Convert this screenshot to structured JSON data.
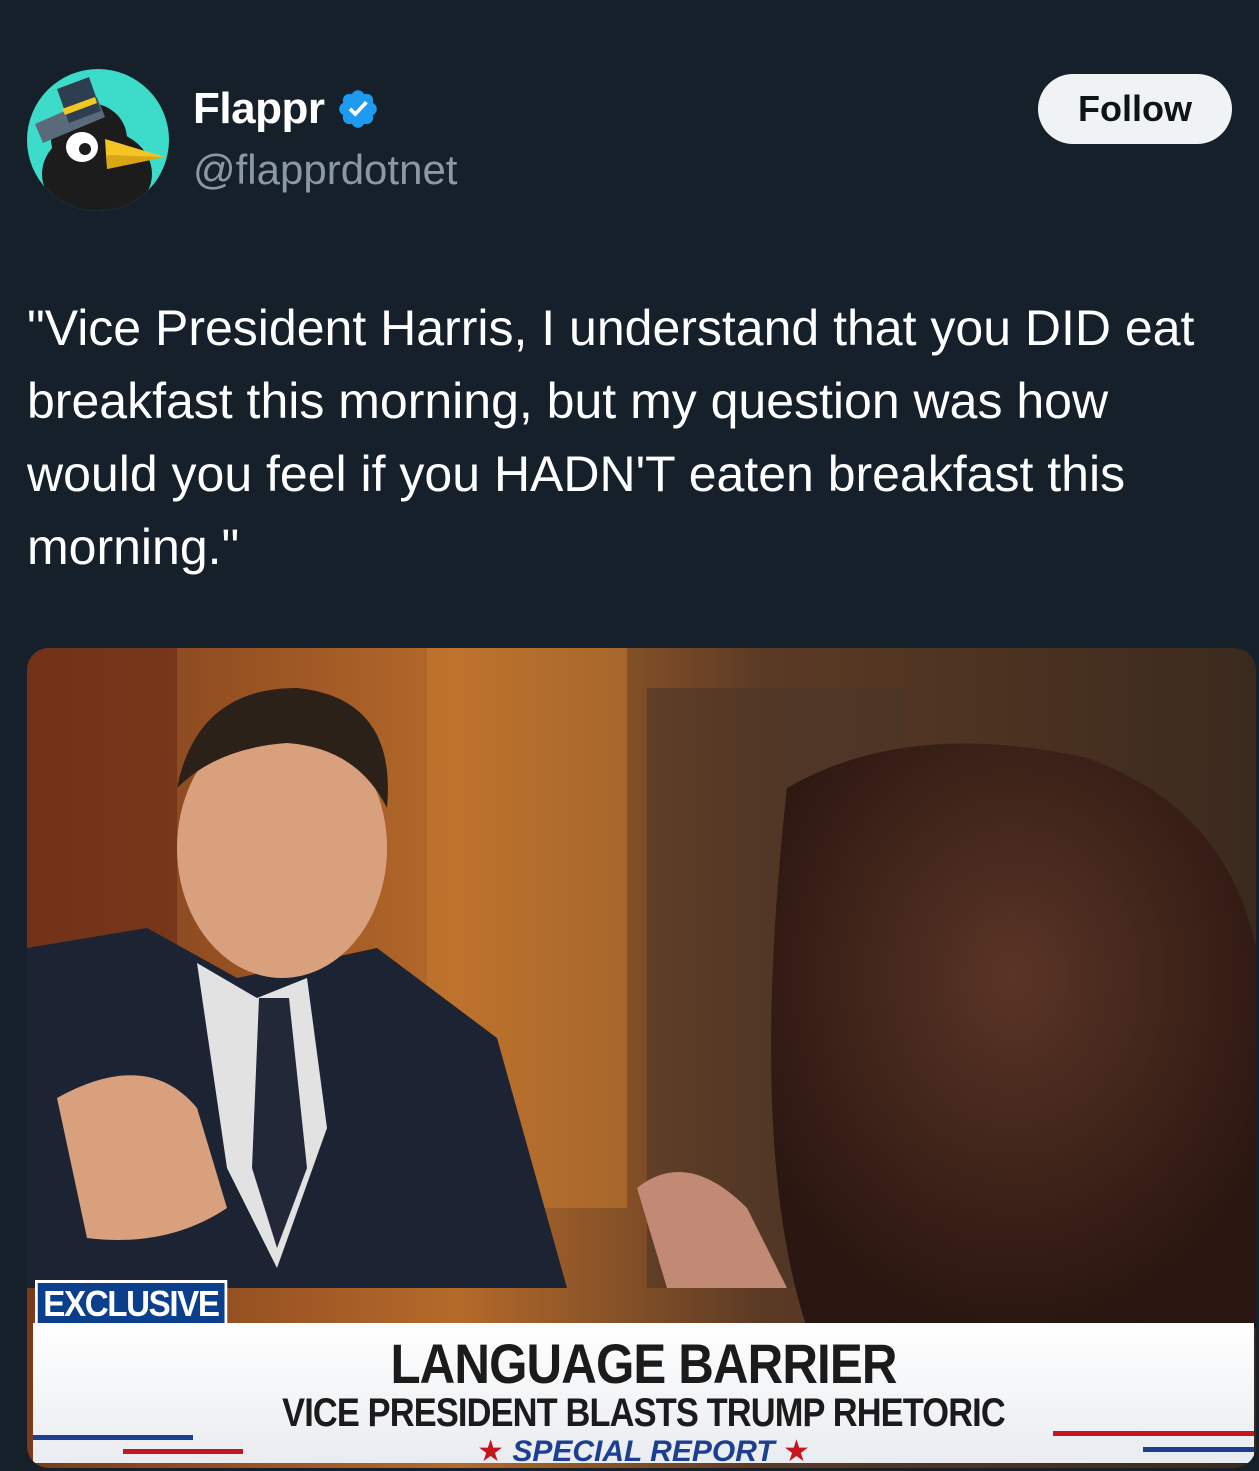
{
  "author": {
    "display_name": "Flappr",
    "handle": "@flapprdotnet",
    "verified": true,
    "avatar_icon": "penguin-top-hat-icon",
    "avatar_bg": "#3ddbc9"
  },
  "actions": {
    "follow_label": "Follow"
  },
  "tweet": {
    "text": "\"Vice President Harris, I understand that you DID eat breakfast this morning, but my question was how would you feel if you HADN'T eaten breakfast this morning.\""
  },
  "media": {
    "badge": "EXCLUSIVE",
    "headline": "LANGUAGE BARRIER",
    "subheadline": "VICE PRESIDENT BLASTS TRUMP RHETORIC",
    "program": "SPECIAL REPORT"
  },
  "colors": {
    "background": "#15202b",
    "verified_blue": "#1d9bf0",
    "follow_bg": "#eff3f4",
    "badge_blue": "#0b3f8c"
  }
}
